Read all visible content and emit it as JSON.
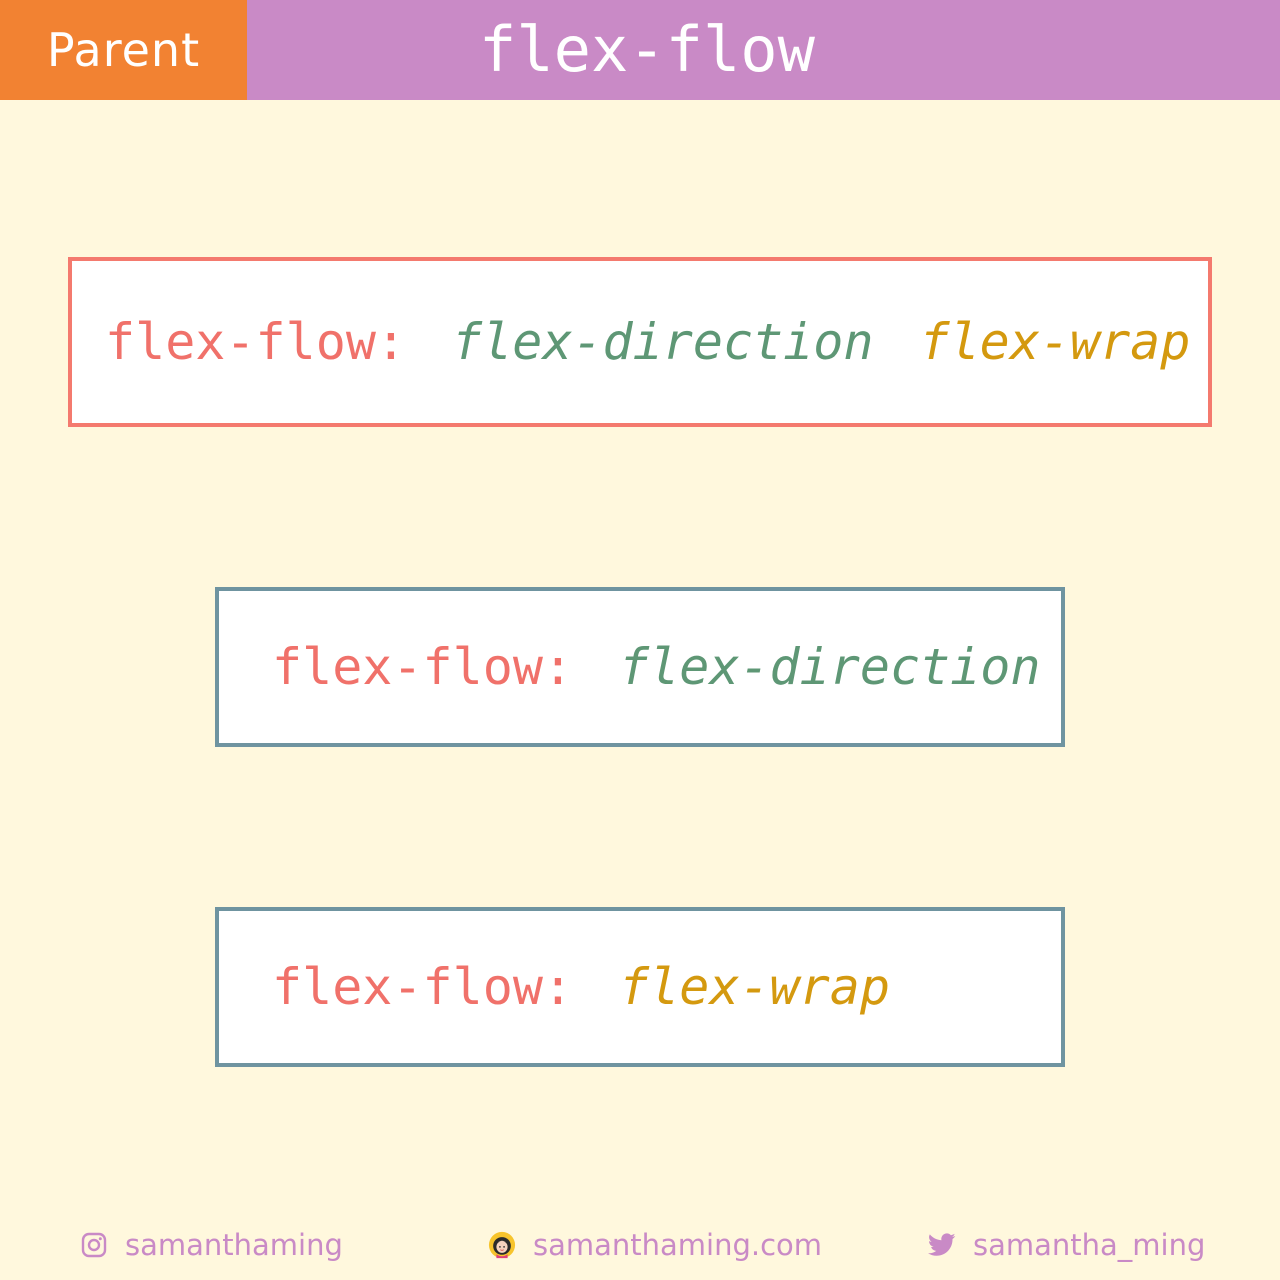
{
  "header": {
    "tag": "Parent",
    "title": "flex-flow"
  },
  "examples": [
    {
      "property": "flex-flow:",
      "direction": "flex-direction",
      "wrap": "flex-wrap"
    },
    {
      "property": "flex-flow:",
      "direction": "flex-direction"
    },
    {
      "property": "flex-flow:",
      "wrap": "flex-wrap"
    }
  ],
  "footer": {
    "instagram": {
      "icon": "instagram-icon",
      "label": "samanthaming"
    },
    "website": {
      "icon": "avatar-icon",
      "label": "samanthaming.com"
    },
    "twitter": {
      "icon": "twitter-icon",
      "label": "samantha_ming"
    }
  },
  "colors": {
    "background": "#fff8dd",
    "header": "#c98ac6",
    "tag": "#f28232",
    "property": "#f0716a",
    "direction": "#5e9775",
    "wrap": "#d4990f",
    "box_primary_border": "#f47a6e",
    "box_secondary_border": "#6f94a0"
  }
}
